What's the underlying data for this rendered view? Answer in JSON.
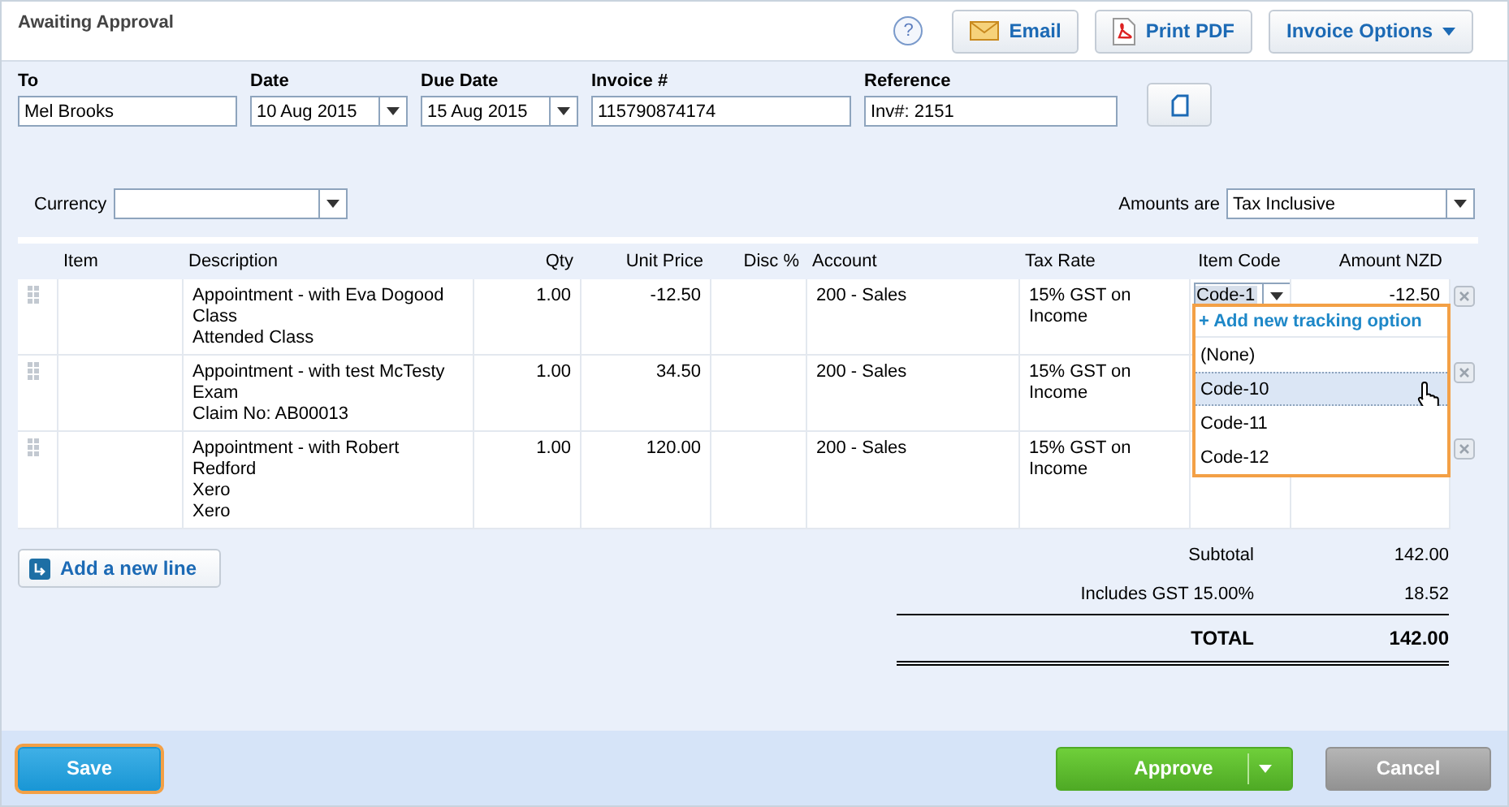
{
  "header": {
    "title": "Awaiting Approval",
    "help": "?",
    "buttons": [
      {
        "label": "Email",
        "kind": "email"
      },
      {
        "label": "Print PDF",
        "kind": "pdf"
      },
      {
        "label": "Invoice Options",
        "kind": "menu"
      }
    ]
  },
  "fields": [
    {
      "label": "To",
      "value": "Mel Brooks",
      "kind": "text"
    },
    {
      "label": "Date",
      "value": "10 Aug 2015",
      "kind": "date"
    },
    {
      "label": "Due Date",
      "value": "15 Aug 2015",
      "kind": "date"
    },
    {
      "label": "Invoice #",
      "value": "115790874174",
      "kind": "text"
    },
    {
      "label": "Reference",
      "value": "Inv#: 2151",
      "kind": "text"
    }
  ],
  "currency": {
    "label": "Currency"
  },
  "amounts_are": {
    "label": "Amounts are",
    "value": "Tax Inclusive"
  },
  "table": {
    "columns": [
      "Item",
      "Description",
      "Qty",
      "Unit Price",
      "Disc %",
      "Account",
      "Tax Rate",
      "Item Code",
      "Amount NZD"
    ],
    "rows": [
      {
        "description": [
          "Appointment - with Eva Dogood",
          "Class",
          "Attended Class"
        ],
        "qty": "1.00",
        "unit_price": "-12.50",
        "account": "200 - Sales",
        "tax_rate": "15% GST on Income",
        "item_code": "Code-1",
        "amount": "-12.50"
      },
      {
        "description": [
          "Appointment - with test McTesty",
          "Exam",
          "Claim No: AB00013"
        ],
        "qty": "1.00",
        "unit_price": "34.50",
        "account": "200 - Sales",
        "tax_rate": "15% GST on Income"
      },
      {
        "description": [
          "Appointment - with Robert",
          "Redford",
          "Xero",
          "Xero"
        ],
        "qty": "1.00",
        "unit_price": "120.00",
        "account": "200 - Sales",
        "tax_rate": "15% GST on Income"
      }
    ]
  },
  "tracking_menu": {
    "add_label": "+ Add new tracking option",
    "options": [
      {
        "label": "(None)",
        "selected": false
      },
      {
        "label": "Code-10",
        "selected": true
      },
      {
        "label": "Code-11",
        "selected": false
      },
      {
        "label": "Code-12",
        "selected": false
      }
    ]
  },
  "add_line": "Add a new line",
  "totals": [
    {
      "label": "Subtotal",
      "value": "142.00",
      "kind": "normal"
    },
    {
      "label": "Includes GST 15.00%",
      "value": "18.52",
      "kind": "normal"
    },
    {
      "label": "TOTAL",
      "value": "142.00",
      "kind": "total"
    }
  ],
  "footer": [
    {
      "label": "Save",
      "kind": "save",
      "focused": true
    },
    {
      "label": "Approve",
      "kind": "approve",
      "focused": false
    },
    {
      "label": "Cancel",
      "kind": "cancel",
      "focused": false
    }
  ]
}
